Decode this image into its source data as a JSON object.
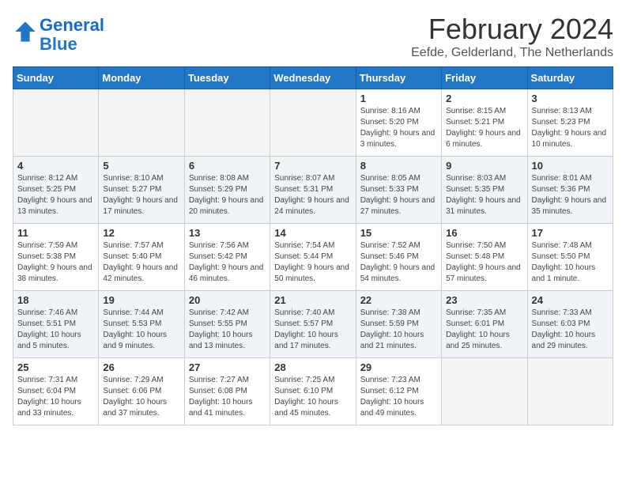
{
  "logo": {
    "line1": "General",
    "line2": "Blue"
  },
  "title": "February 2024",
  "subtitle": "Eefde, Gelderland, The Netherlands",
  "days_of_week": [
    "Sunday",
    "Monday",
    "Tuesday",
    "Wednesday",
    "Thursday",
    "Friday",
    "Saturday"
  ],
  "weeks": [
    [
      {
        "day": "",
        "content": ""
      },
      {
        "day": "",
        "content": ""
      },
      {
        "day": "",
        "content": ""
      },
      {
        "day": "",
        "content": ""
      },
      {
        "day": "1",
        "content": "Sunrise: 8:16 AM\nSunset: 5:20 PM\nDaylight: 9 hours\nand 3 minutes."
      },
      {
        "day": "2",
        "content": "Sunrise: 8:15 AM\nSunset: 5:21 PM\nDaylight: 9 hours\nand 6 minutes."
      },
      {
        "day": "3",
        "content": "Sunrise: 8:13 AM\nSunset: 5:23 PM\nDaylight: 9 hours\nand 10 minutes."
      }
    ],
    [
      {
        "day": "4",
        "content": "Sunrise: 8:12 AM\nSunset: 5:25 PM\nDaylight: 9 hours\nand 13 minutes."
      },
      {
        "day": "5",
        "content": "Sunrise: 8:10 AM\nSunset: 5:27 PM\nDaylight: 9 hours\nand 17 minutes."
      },
      {
        "day": "6",
        "content": "Sunrise: 8:08 AM\nSunset: 5:29 PM\nDaylight: 9 hours\nand 20 minutes."
      },
      {
        "day": "7",
        "content": "Sunrise: 8:07 AM\nSunset: 5:31 PM\nDaylight: 9 hours\nand 24 minutes."
      },
      {
        "day": "8",
        "content": "Sunrise: 8:05 AM\nSunset: 5:33 PM\nDaylight: 9 hours\nand 27 minutes."
      },
      {
        "day": "9",
        "content": "Sunrise: 8:03 AM\nSunset: 5:35 PM\nDaylight: 9 hours\nand 31 minutes."
      },
      {
        "day": "10",
        "content": "Sunrise: 8:01 AM\nSunset: 5:36 PM\nDaylight: 9 hours\nand 35 minutes."
      }
    ],
    [
      {
        "day": "11",
        "content": "Sunrise: 7:59 AM\nSunset: 5:38 PM\nDaylight: 9 hours\nand 38 minutes."
      },
      {
        "day": "12",
        "content": "Sunrise: 7:57 AM\nSunset: 5:40 PM\nDaylight: 9 hours\nand 42 minutes."
      },
      {
        "day": "13",
        "content": "Sunrise: 7:56 AM\nSunset: 5:42 PM\nDaylight: 9 hours\nand 46 minutes."
      },
      {
        "day": "14",
        "content": "Sunrise: 7:54 AM\nSunset: 5:44 PM\nDaylight: 9 hours\nand 50 minutes."
      },
      {
        "day": "15",
        "content": "Sunrise: 7:52 AM\nSunset: 5:46 PM\nDaylight: 9 hours\nand 54 minutes."
      },
      {
        "day": "16",
        "content": "Sunrise: 7:50 AM\nSunset: 5:48 PM\nDaylight: 9 hours\nand 57 minutes."
      },
      {
        "day": "17",
        "content": "Sunrise: 7:48 AM\nSunset: 5:50 PM\nDaylight: 10 hours\nand 1 minute."
      }
    ],
    [
      {
        "day": "18",
        "content": "Sunrise: 7:46 AM\nSunset: 5:51 PM\nDaylight: 10 hours\nand 5 minutes."
      },
      {
        "day": "19",
        "content": "Sunrise: 7:44 AM\nSunset: 5:53 PM\nDaylight: 10 hours\nand 9 minutes."
      },
      {
        "day": "20",
        "content": "Sunrise: 7:42 AM\nSunset: 5:55 PM\nDaylight: 10 hours\nand 13 minutes."
      },
      {
        "day": "21",
        "content": "Sunrise: 7:40 AM\nSunset: 5:57 PM\nDaylight: 10 hours\nand 17 minutes."
      },
      {
        "day": "22",
        "content": "Sunrise: 7:38 AM\nSunset: 5:59 PM\nDaylight: 10 hours\nand 21 minutes."
      },
      {
        "day": "23",
        "content": "Sunrise: 7:35 AM\nSunset: 6:01 PM\nDaylight: 10 hours\nand 25 minutes."
      },
      {
        "day": "24",
        "content": "Sunrise: 7:33 AM\nSunset: 6:03 PM\nDaylight: 10 hours\nand 29 minutes."
      }
    ],
    [
      {
        "day": "25",
        "content": "Sunrise: 7:31 AM\nSunset: 6:04 PM\nDaylight: 10 hours\nand 33 minutes."
      },
      {
        "day": "26",
        "content": "Sunrise: 7:29 AM\nSunset: 6:06 PM\nDaylight: 10 hours\nand 37 minutes."
      },
      {
        "day": "27",
        "content": "Sunrise: 7:27 AM\nSunset: 6:08 PM\nDaylight: 10 hours\nand 41 minutes."
      },
      {
        "day": "28",
        "content": "Sunrise: 7:25 AM\nSunset: 6:10 PM\nDaylight: 10 hours\nand 45 minutes."
      },
      {
        "day": "29",
        "content": "Sunrise: 7:23 AM\nSunset: 6:12 PM\nDaylight: 10 hours\nand 49 minutes."
      },
      {
        "day": "",
        "content": ""
      },
      {
        "day": "",
        "content": ""
      }
    ]
  ]
}
